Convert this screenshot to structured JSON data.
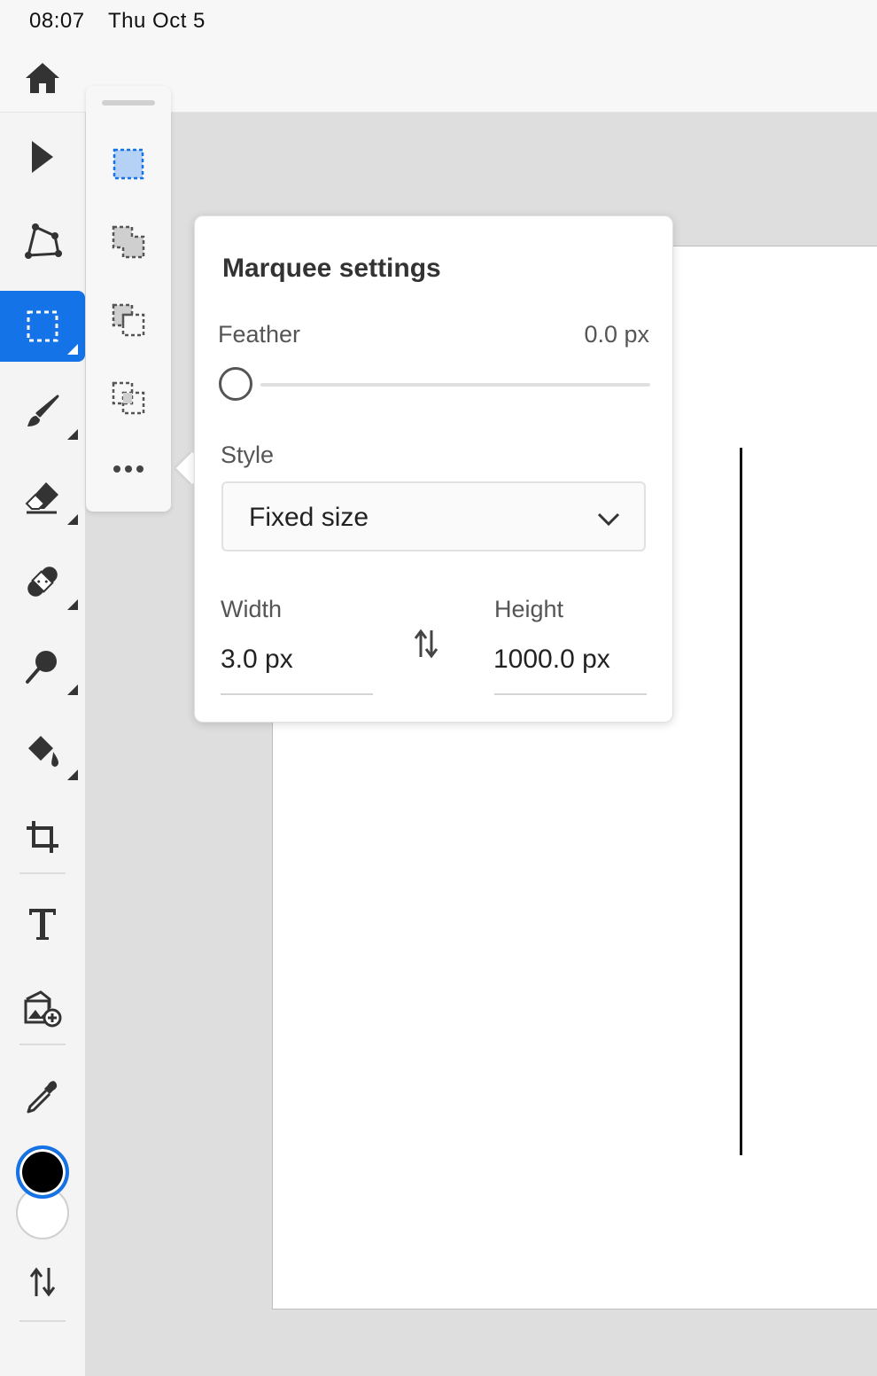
{
  "status_bar": {
    "time": "08:07",
    "date": "Thu Oct 5"
  },
  "toolbar": {
    "tools": [
      {
        "name": "home-button",
        "icon": "home-icon"
      },
      {
        "name": "select-tool",
        "icon": "arrow-pointer-icon"
      },
      {
        "name": "lasso-tool",
        "icon": "polygon-lasso-icon"
      },
      {
        "name": "marquee-tool",
        "icon": "rectangle-marquee-icon",
        "active": true
      },
      {
        "name": "brush-tool",
        "icon": "brush-icon"
      },
      {
        "name": "eraser-tool",
        "icon": "eraser-icon"
      },
      {
        "name": "healing-tool",
        "icon": "bandage-icon"
      },
      {
        "name": "clone-tool",
        "icon": "stamp-icon"
      },
      {
        "name": "fill-tool",
        "icon": "paint-bucket-icon"
      },
      {
        "name": "crop-tool",
        "icon": "crop-icon"
      },
      {
        "name": "type-tool",
        "icon": "text-icon"
      },
      {
        "name": "place-image-tool",
        "icon": "add-image-icon"
      },
      {
        "name": "eyedropper-tool",
        "icon": "eyedropper-icon"
      },
      {
        "name": "swap-colors",
        "icon": "swap-vertical-icon"
      }
    ],
    "foreground_color": "#000000",
    "background_color": "#ffffff",
    "accent_color": "#1473e6"
  },
  "flyout": {
    "items": [
      {
        "name": "marquee-new-selection",
        "icon": "marquee-new-icon",
        "active": true
      },
      {
        "name": "marquee-add",
        "icon": "marquee-add-icon"
      },
      {
        "name": "marquee-subtract",
        "icon": "marquee-subtract-icon"
      },
      {
        "name": "marquee-intersect",
        "icon": "marquee-intersect-icon"
      },
      {
        "name": "more-options",
        "icon": "more-horizontal-icon"
      }
    ]
  },
  "marquee_settings": {
    "title": "Marquee settings",
    "feather_label": "Feather",
    "feather_value": "0.0 px",
    "feather_level": 0,
    "style_label": "Style",
    "style_value": "Fixed size",
    "width_label": "Width",
    "width_value": "3.0 px",
    "height_label": "Height",
    "height_value": "1000.0 px"
  }
}
